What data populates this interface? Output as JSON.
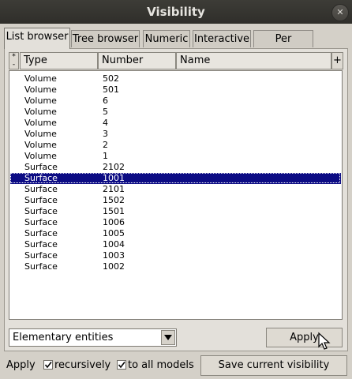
{
  "window": {
    "title": "Visibility",
    "close_glyph": "✕",
    "close_icon": "close-icon"
  },
  "tabs": [
    {
      "label": "List browser",
      "active": true
    },
    {
      "label": "Tree browser",
      "active": false
    },
    {
      "label": "Numeric",
      "active": false
    },
    {
      "label": "Interactive",
      "active": false
    },
    {
      "label": "Per window",
      "active": false
    }
  ],
  "list": {
    "sort_button": {
      "top": "*",
      "bottom": "-"
    },
    "columns": [
      "Type",
      "Number",
      "Name"
    ],
    "add_button": "+",
    "rows": [
      {
        "type": "Volume",
        "number": "502",
        "selected": false
      },
      {
        "type": "Volume",
        "number": "501",
        "selected": false
      },
      {
        "type": "Volume",
        "number": "6",
        "selected": false
      },
      {
        "type": "Volume",
        "number": "5",
        "selected": false
      },
      {
        "type": "Volume",
        "number": "4",
        "selected": false
      },
      {
        "type": "Volume",
        "number": "3",
        "selected": false
      },
      {
        "type": "Volume",
        "number": "2",
        "selected": false
      },
      {
        "type": "Volume",
        "number": "1",
        "selected": false
      },
      {
        "type": "Surface",
        "number": "2102",
        "selected": false
      },
      {
        "type": "Surface",
        "number": "1001",
        "selected": true
      },
      {
        "type": "Surface",
        "number": "2101",
        "selected": false
      },
      {
        "type": "Surface",
        "number": "1502",
        "selected": false
      },
      {
        "type": "Surface",
        "number": "1501",
        "selected": false
      },
      {
        "type": "Surface",
        "number": "1006",
        "selected": false
      },
      {
        "type": "Surface",
        "number": "1005",
        "selected": false
      },
      {
        "type": "Surface",
        "number": "1004",
        "selected": false
      },
      {
        "type": "Surface",
        "number": "1003",
        "selected": false
      },
      {
        "type": "Surface",
        "number": "1002",
        "selected": false
      }
    ]
  },
  "controls": {
    "entity_select": {
      "value": "Elementary entities",
      "icon": "dropdown-arrow-icon"
    },
    "apply_label": "Apply",
    "apply_prefix": "Apply",
    "recursively": {
      "label": "recursively",
      "checked": true
    },
    "to_all_models": {
      "label": "to all models",
      "checked": true
    },
    "save_label": "Save current visibility"
  },
  "colors": {
    "selection": "#0c0c84",
    "titlebar": "#3d3c37",
    "background": "#d4d0c8"
  }
}
